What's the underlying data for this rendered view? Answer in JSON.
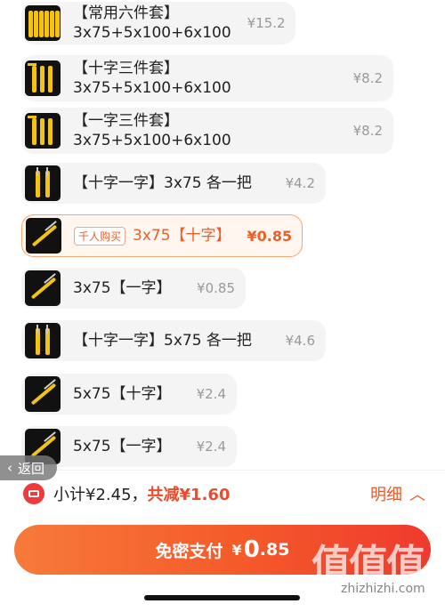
{
  "options": [
    {
      "title": "【常用六件套】",
      "subtitle": "3x75+5x100+6x100",
      "price": "¥15.2",
      "thumb": "six-screwdrivers"
    },
    {
      "title": "【十字三件套】",
      "subtitle": "3x75+5x100+6x100",
      "price": "¥8.2",
      "thumb": "three-screwdrivers"
    },
    {
      "title": "【一字三件套】",
      "subtitle": "3x75+5x100+6x100",
      "price": "¥8.2",
      "thumb": "three-screwdrivers"
    },
    {
      "title": "【十字一字】3x75 各一把",
      "price": "¥4.2",
      "thumb": "two-screwdrivers"
    },
    {
      "tag": "千人购买",
      "title": "3x75【十字】",
      "price": "¥0.85",
      "thumb": "single-screwdriver",
      "selected": true
    },
    {
      "title": "3x75【一字】",
      "price": "¥0.85",
      "thumb": "single-screwdriver"
    },
    {
      "title": "【十字一字】5x75 各一把",
      "price": "¥4.6",
      "thumb": "two-screwdrivers"
    },
    {
      "title": "5x75【十字】",
      "price": "¥2.4",
      "thumb": "single-screwdriver"
    },
    {
      "title": "5x75【一字】",
      "price": "¥2.4",
      "thumb": "single-screwdriver"
    }
  ],
  "back": {
    "label": "返回",
    "icon": "chevron-left-icon"
  },
  "summary": {
    "icon": "coupon-ticket-icon",
    "subtotal": "小计¥2.45，",
    "saved": "共减¥1.60",
    "detail_label": "明细",
    "detail_icon": "chevron-up-icon"
  },
  "pay_button": {
    "label": "免密支付",
    "currency": "¥",
    "amount_int": "0",
    "amount_dec": ".85"
  },
  "watermark": {
    "logo": "值值值",
    "text": "zhizhizhi.com"
  },
  "colors": {
    "accent": "#f45a2a",
    "selected_border": "#f3a772",
    "selected_bg": "#fff6ef",
    "price_grey": "#999999"
  }
}
